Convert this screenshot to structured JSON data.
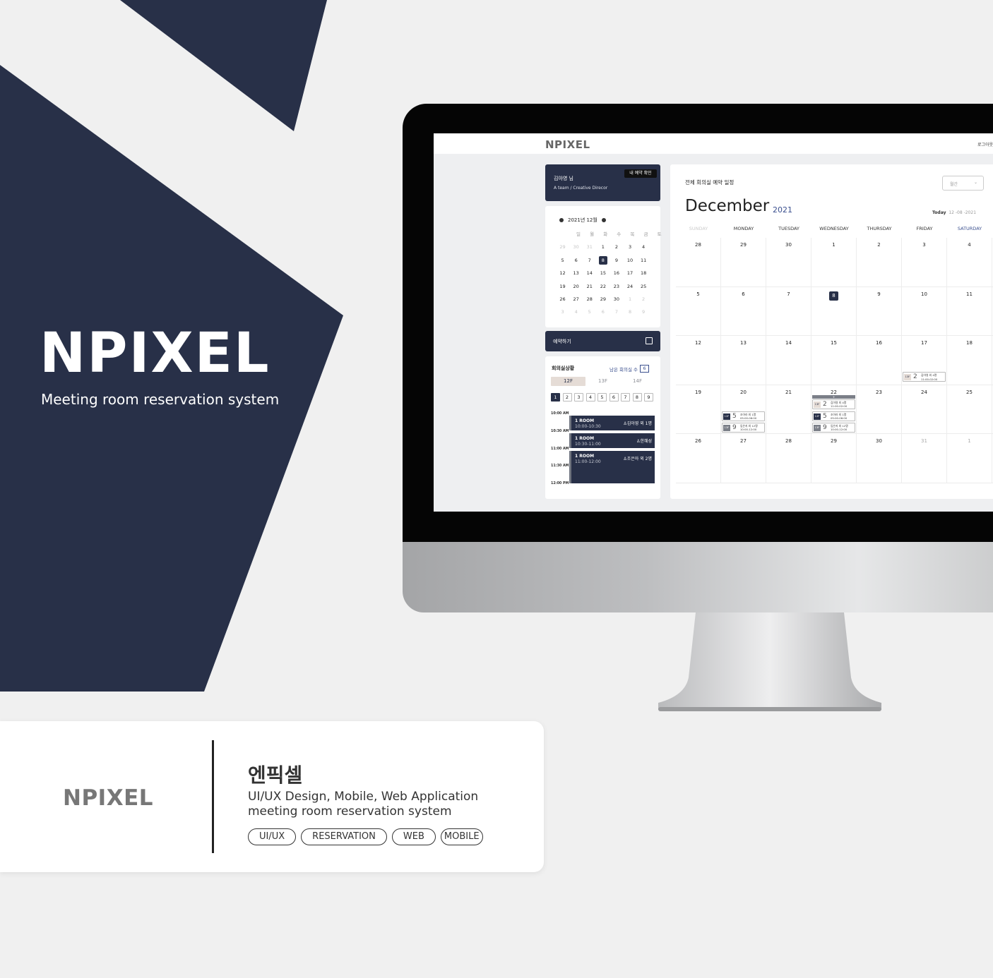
{
  "colors": {
    "navy": "#283048",
    "background": "#f0f0f0",
    "accent_blue": "#3a4f8e",
    "floor_tab": "#e5dcd6"
  },
  "hero": {
    "title": "NPIXEL",
    "subtitle": "Meeting room reservation system"
  },
  "app": {
    "logo": "NPIXEL",
    "logout": "로그아웃",
    "user": {
      "name": "김아영 님",
      "role": "A team / Creative Direcor",
      "my_reservation_button": "내 예약 확인"
    },
    "mini_calendar": {
      "month_label": "2021년 12월",
      "weekdays": [
        "일",
        "월",
        "화",
        "수",
        "목",
        "금",
        "토"
      ],
      "weeks": [
        [
          "29",
          "30",
          "31",
          "1",
          "2",
          "3",
          "4"
        ],
        [
          "5",
          "6",
          "7",
          "8",
          "9",
          "10",
          "11"
        ],
        [
          "12",
          "13",
          "14",
          "15",
          "16",
          "17",
          "18"
        ],
        [
          "19",
          "20",
          "21",
          "22",
          "23",
          "24",
          "25"
        ],
        [
          "26",
          "27",
          "28",
          "29",
          "30",
          "1",
          "2"
        ],
        [
          "3",
          "4",
          "5",
          "6",
          "7",
          "8",
          "9"
        ]
      ],
      "selected": "8"
    },
    "reserve_button": "예약하기",
    "room_status": {
      "title": "회의실상황",
      "remaining_label": "남은 회의실 수",
      "remaining_count": "6",
      "floors": [
        "12F",
        "13F",
        "14F"
      ],
      "active_floor": "12F",
      "rooms": [
        "1",
        "2",
        "3",
        "4",
        "5",
        "6",
        "7",
        "8",
        "9"
      ],
      "active_room": "1",
      "times": [
        "10:00 AM",
        "10:30 AM",
        "11:00 AM",
        "11:30 AM",
        "12:00 PM"
      ],
      "slots": [
        {
          "room": "1 ROOM",
          "time": "10:00-10:30",
          "who": "김아영 외 1명"
        },
        {
          "room": "1 ROOM",
          "time": "10:30-11:00",
          "who": "한혜성"
        },
        {
          "room": "1 ROOM",
          "time": "11:00-12:00",
          "who": "조은아 외 2명"
        }
      ]
    },
    "calendar": {
      "title": "전체 회의실 예약 일정",
      "view_select": "월간",
      "view_select_arrow": "⌄",
      "month": "December",
      "year": "2021",
      "today_label": "Today",
      "today_date": "12 -08 -2021",
      "weekdays": [
        "SUNDAY",
        "MONDAY",
        "TUESDAY",
        "WEDNESDAY",
        "THURSDAY",
        "FRIDAY",
        "SATURDAY"
      ],
      "weeks": [
        [
          "28",
          "29",
          "30",
          "1",
          "2",
          "3",
          "4"
        ],
        [
          "5",
          "6",
          "7",
          "8",
          "9",
          "10",
          "11"
        ],
        [
          "12",
          "13",
          "14",
          "15",
          "16",
          "17",
          "18"
        ],
        [
          "19",
          "20",
          "21",
          "22",
          "23",
          "24",
          "25"
        ],
        [
          "26",
          "27",
          "28",
          "29",
          "30",
          "31",
          "1"
        ]
      ],
      "today": "8",
      "expand_label": "+",
      "events": [
        {
          "floor": "13F",
          "count": "2",
          "line1": "김아영 외 4명",
          "line2": "11:00-02:00"
        },
        {
          "floor": "12F",
          "count": "5",
          "line1": "조아라 외 1명",
          "line2": "05:00-06:00"
        },
        {
          "floor": "13F",
          "count": "9",
          "line1": "임은지 외 12명",
          "line2": "10:00-12:00"
        },
        {
          "floor": "13F",
          "count": "2",
          "line1": "김아영 외 4명",
          "line2": "11:00-02:00"
        },
        {
          "floor": "12F",
          "count": "5",
          "line1": "조아라 외 1명",
          "line2": "05:00-06:00"
        },
        {
          "floor": "13F",
          "count": "9",
          "line1": "임은지 외 12명",
          "line2": "10:00-12:00"
        }
      ]
    }
  },
  "info": {
    "logo": "NPIXEL",
    "name": "엔픽셀",
    "line1": "UI/UX Design, Mobile, Web Application",
    "line2": "meeting room reservation system",
    "tags": [
      "UI/UX",
      "RESERVATION",
      "WEB",
      "MOBILE"
    ]
  }
}
